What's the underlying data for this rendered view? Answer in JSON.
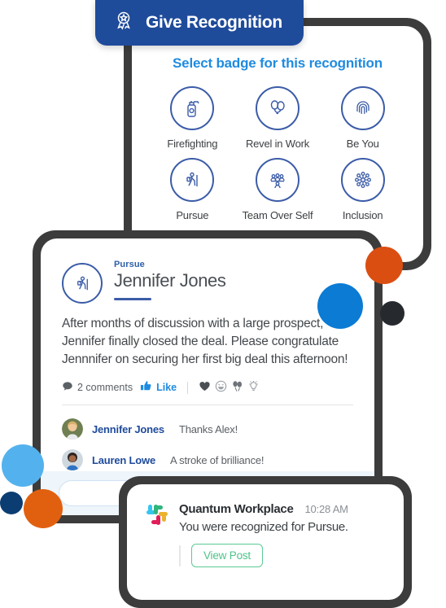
{
  "give_recognition": {
    "label": "Give Recognition",
    "icon": "award-ribbon-icon",
    "background": "#1F4B9B"
  },
  "badge_picker": {
    "heading": "Select badge for this recognition",
    "heading_color": "#1F8BE0",
    "badges": [
      {
        "label": "Firefighting",
        "icon": "fire-extinguisher-icon"
      },
      {
        "label": "Revel in Work",
        "icon": "balloons-icon"
      },
      {
        "label": "Be You",
        "icon": "fingerprint-icon"
      },
      {
        "label": "Pursue",
        "icon": "hiker-icon"
      },
      {
        "label": "Team Over Self",
        "icon": "group-people-icon"
      },
      {
        "label": "Inclusion",
        "icon": "network-nodes-icon"
      }
    ]
  },
  "post": {
    "badge_icon": "hiker-icon",
    "badge_name": "Pursue",
    "recipient": "Jennifer Jones",
    "body": "After months of discussion with a large prospect, Jennifer finally closed the deal. Please congratulate Jennnifer on securing her first big deal this afternoon!",
    "comments_count": "2 comments",
    "like_label": "Like",
    "reactions": [
      "heart-icon",
      "grinning-face-icon",
      "balloons-icon",
      "lightbulb-icon"
    ],
    "comments": [
      {
        "name": "Jennifer Jones",
        "text": "Thanks Alex!",
        "avatar": "avatar-jennifer"
      },
      {
        "name": "Lauren Lowe",
        "text": "A stroke of brilliance!",
        "avatar": "avatar-lauren"
      }
    ],
    "composer_placeholder": ""
  },
  "toast": {
    "icon": "slack-logo-icon",
    "app_name": "Quantum Workplace",
    "time": "10:28 AM",
    "message": "You were recognized for Pursue.",
    "button_label": "View Post",
    "button_color": "#4CC38A"
  },
  "decor": {
    "circles": [
      {
        "name": "orange-circle-right",
        "color": "#DB4E12"
      },
      {
        "name": "blue-circle-right",
        "color": "#0B7BD4"
      },
      {
        "name": "dark-circle-right",
        "color": "#26292E"
      },
      {
        "name": "light-blue-circle-left",
        "color": "#53B2EE"
      },
      {
        "name": "navy-circle-left",
        "color": "#0B3D72"
      },
      {
        "name": "orange-circle-left",
        "color": "#E1600F"
      }
    ]
  }
}
